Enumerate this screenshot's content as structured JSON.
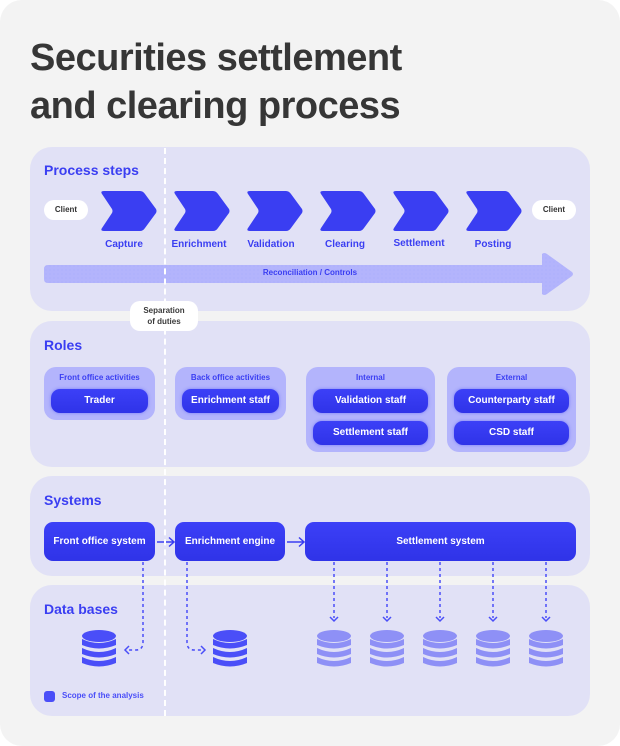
{
  "title": "Securities settlement\nand clearing process",
  "colors": {
    "accent": "#3a3ef2",
    "panel": "#e1e1f6",
    "group": "#b3b4fc",
    "db_in_scope": "#4a4ef8",
    "db_out_scope": "#8e90f6",
    "background": "#f3f3f3"
  },
  "separation": {
    "label": "Separation\nof duties"
  },
  "process": {
    "title": "Process steps",
    "client_start": "Client",
    "client_end": "Client",
    "steps": [
      "Capture",
      "Enrichment",
      "Validation",
      "Clearing",
      "Settlement",
      "Posting"
    ],
    "arrow_label": "Reconciliation / Controls"
  },
  "roles": {
    "title": "Roles",
    "groups": [
      {
        "title": "Front office activities",
        "items": [
          "Trader"
        ]
      },
      {
        "title": "Back office activities",
        "items": [
          "Enrichment staff"
        ]
      },
      {
        "title": "Internal",
        "items": [
          "Validation staff",
          "Settlement staff"
        ]
      },
      {
        "title": "External",
        "items": [
          "Counterparty staff",
          "CSD staff"
        ]
      }
    ]
  },
  "systems": {
    "title": "Systems",
    "items": [
      "Front office system",
      "Enrichment engine",
      "Settlement system"
    ]
  },
  "databases": {
    "title": "Data bases",
    "in_scope_count": 2,
    "out_of_scope_count": 5
  },
  "legend": {
    "label": "Scope of the analysis"
  }
}
